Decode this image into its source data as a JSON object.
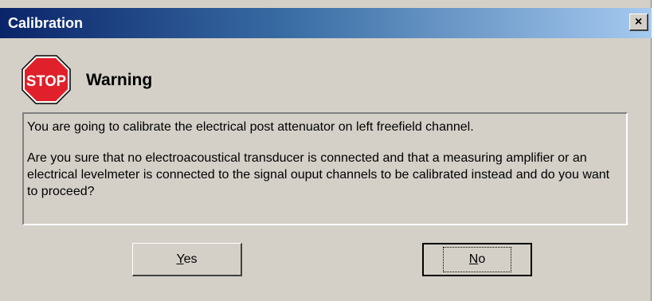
{
  "window": {
    "title": "Calibration",
    "close_label": "×"
  },
  "header": {
    "icon_text": "STOP",
    "heading": "Warning"
  },
  "message": {
    "line1": "You are going to calibrate the electrical post attenuator on left freefield channel.",
    "line2": "Are you sure that no electroacoustical transducer is connected and that a measuring amplifier or an electrical levelmeter is connected to the signal ouput channels to be calibrated instead and do you want to proceed?"
  },
  "buttons": {
    "yes": {
      "mnemonic": "Y",
      "rest": "es"
    },
    "no": {
      "mnemonic": "N",
      "rest": "o"
    }
  },
  "colors": {
    "title_start": "#0a246a",
    "title_end": "#a6caf0",
    "stop_red": "#e0202a"
  }
}
